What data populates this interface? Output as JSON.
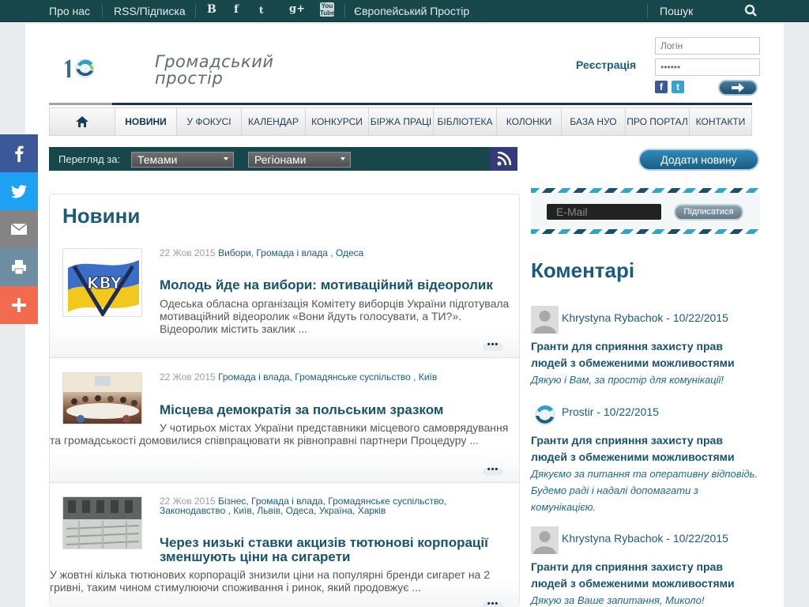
{
  "topbar": {
    "about": "Про нас",
    "rss": "RSS/Підписка",
    "social": [
      {
        "name": "vk",
        "glyph": "B"
      },
      {
        "name": "facebook",
        "glyph": "f"
      },
      {
        "name": "twitter",
        "glyph": "t"
      },
      {
        "name": "google-plus",
        "glyph": "g+"
      },
      {
        "name": "youtube",
        "glyph": "You Tube"
      }
    ],
    "european": "Європейський Простір",
    "search": "Пошук"
  },
  "header": {
    "logo_line1": "Громадський",
    "logo_line2": "простір",
    "register": "Реєстрація",
    "login_placeholder": "Логін",
    "password_placeholder": "••••••"
  },
  "nav": {
    "items": [
      {
        "label": "Новини",
        "active": true
      },
      {
        "label": "У фокусі"
      },
      {
        "label": "Календар"
      },
      {
        "label": "Конкурси"
      },
      {
        "label": "Біржа праці"
      },
      {
        "label": "Бібліотека"
      },
      {
        "label": "Колонки"
      },
      {
        "label": "База НУО"
      },
      {
        "label": "Про портал"
      },
      {
        "label": "Контакти"
      }
    ]
  },
  "filter": {
    "label": "Перегляд за:",
    "by_topic": "Темами",
    "by_region": "Регіонами"
  },
  "add_news": "Додати новину",
  "subscribe": {
    "email_placeholder": "E-Mail",
    "button": "Підписатися"
  },
  "news": {
    "title": "Новини",
    "articles": [
      {
        "date": "22 Жов 2015",
        "categories": "Вибори, Громада і влада , Одеса",
        "title": "Молодь йде на вибори: мотиваційний відеоролик",
        "text": "Одеська обласна організація Комітету виборців України підготувала мотиваційний відеоролик «Вони йдуть голосувати, а ТИ?». Відеоролик містить заклик ..."
      },
      {
        "date": "22 Жов 2015",
        "categories": "Громада і влада, Громадянське суспільство , Київ",
        "title": "Місцева демократія за польським зразком",
        "text": "У чотирьох містах України представники місцевого самоврядування та громадськості домовилися співпрацювати як рівноправні партнери Процедуру ..."
      },
      {
        "date": "22 Жов 2015",
        "categories": "Бізнес, Громада і влада, Громадянське суспільство, Законодавство , Київ, Львів, Одеса, Україна, Харків",
        "title": "Через низькі ставки акцизів тютюнові корпорації зменшують ціни на сигарети",
        "text": "У жовтні кілька тютюнових корпорацій знизили ціни на популярні бренди сигарет на 2 гривні, таким чином стимулюючи споживання і ринок, який продовжує ..."
      }
    ],
    "more": "•••"
  },
  "comments": {
    "title": "Коментарі",
    "items": [
      {
        "author": "Khrystyna Rybachok - 10/22/2015",
        "topic": "Гранти для сприяння захисту прав людей з обмеженими можливостями",
        "text": "Дякую і Вам, за простір для комунікації!"
      },
      {
        "author": "Prostir - 10/22/2015",
        "topic": "Гранти для сприяння захисту прав людей з обмеженими можливостями",
        "text": "Дякуємо за питання та оперативну відповідь. Будемо раді і надалі допомагати з комунікацією."
      },
      {
        "author": "Khrystyna Rybachok - 10/22/2015",
        "topic": "Гранти для сприяння захисту прав людей з обмеженими можливостями",
        "text": "Дякую за Ваше запитання, Миколо!"
      }
    ]
  },
  "share_bar": [
    {
      "name": "facebook",
      "color": "#3b5998"
    },
    {
      "name": "twitter",
      "color": "#1da1f2"
    },
    {
      "name": "email",
      "color": "#848484"
    },
    {
      "name": "print",
      "color": "#6c8da2"
    },
    {
      "name": "more",
      "color": "#f26b4f"
    }
  ]
}
